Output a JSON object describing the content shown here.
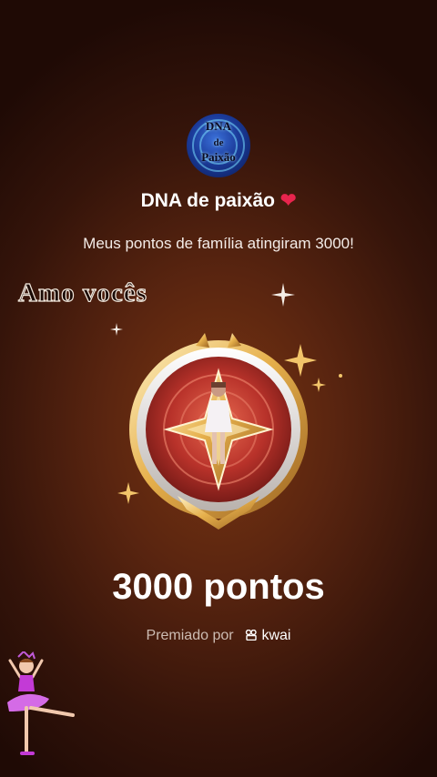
{
  "group": {
    "avatar_text_top": "DNA",
    "avatar_text_mid": "de",
    "avatar_text_bottom": "Paixão",
    "name": "DNA de paixão",
    "heart_glyph": "❤"
  },
  "message": "Meus pontos de família atingiram 3000!",
  "sticker_text": "Amo vocês",
  "badge": {
    "icon": "gold-star-medal-icon"
  },
  "points_label": "3000 pontos",
  "award": {
    "prefix": "Premiado por",
    "brand": "kwai",
    "brand_icon": "kwai-logo-icon"
  },
  "colors": {
    "background": "#5a2510",
    "heart": "#e8254d",
    "gold": "#e8b050"
  }
}
